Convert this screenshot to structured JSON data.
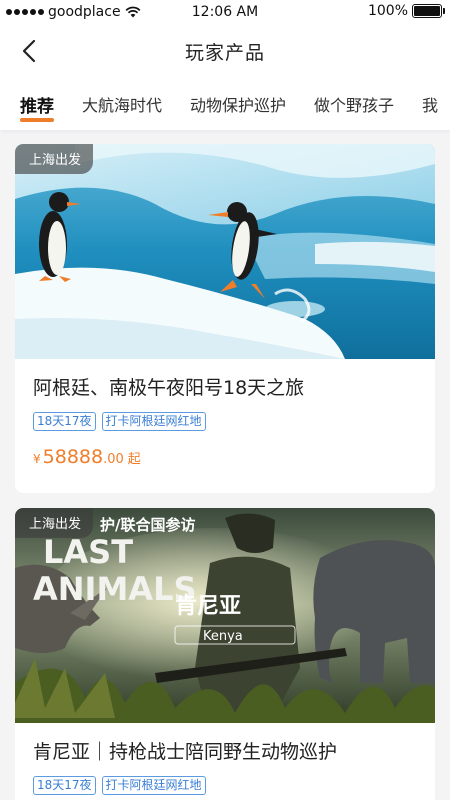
{
  "status_bar": {
    "carrier": "goodplace",
    "time": "12:06 AM",
    "battery": "100%",
    "battery_level": 1.0
  },
  "header": {
    "title": "玩家产品",
    "back_icon": "chevron-left-icon"
  },
  "tabs": [
    {
      "label": "推荐",
      "active": true
    },
    {
      "label": "大航海时代",
      "active": false
    },
    {
      "label": "动物保护巡护",
      "active": false
    },
    {
      "label": "做个野孩子",
      "active": false
    },
    {
      "label": "我",
      "active": false
    }
  ],
  "colors": {
    "accent": "#f07d2a",
    "tag_blue": "#3a7fd5",
    "background": "#f4f4f5"
  },
  "products": [
    {
      "badge": "上海出发",
      "title": "阿根廷、南极午夜阳号18天之旅",
      "tags": [
        "18天17夜",
        "打卡阿根廷网红地"
      ],
      "price": {
        "symbol": "¥",
        "integer": "58888",
        "decimal": ".00",
        "suffix": "起"
      }
    },
    {
      "badge": "上海出发",
      "poster_text": {
        "top": "护/联合国参访",
        "line1": "LAST",
        "line2": "ANIMALS",
        "cn": "肯尼亚",
        "en": "Kenya"
      },
      "title": "肯尼亚｜持枪战士陪同野生动物巡护",
      "tags": [
        "18天17夜",
        "打卡阿根廷网红地"
      ]
    }
  ]
}
